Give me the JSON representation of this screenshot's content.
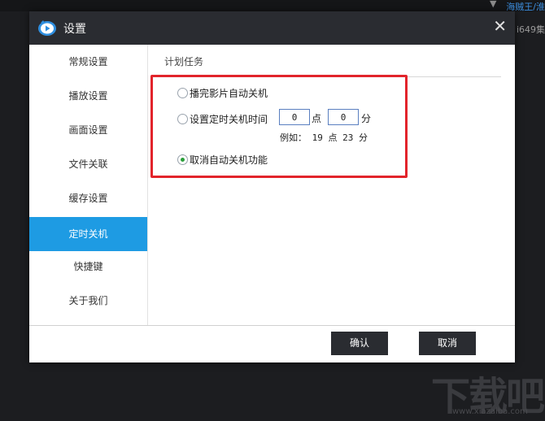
{
  "background": {
    "top_right_text": "海贼王/淮",
    "top_right_text2": "i649集",
    "chevron": "▼"
  },
  "dialog": {
    "title": "设置",
    "close_symbol": "✕",
    "sidebar": {
      "items": [
        {
          "label": "常规设置",
          "active": false
        },
        {
          "label": "播放设置",
          "active": false
        },
        {
          "label": "画面设置",
          "active": false
        },
        {
          "label": "文件关联",
          "active": false
        },
        {
          "label": "缓存设置",
          "active": false
        },
        {
          "label": "定时关机",
          "active": true
        },
        {
          "label": "快捷键",
          "active": false
        },
        {
          "label": "关于我们",
          "active": false
        }
      ]
    },
    "content": {
      "section_title": "计划任务",
      "options": {
        "after_movie": {
          "label": "播完影片自动关机",
          "checked": false
        },
        "set_time": {
          "label": "设置定时关机时间",
          "checked": false
        },
        "cancel": {
          "label": "取消自动关机功能",
          "checked": true
        }
      },
      "hour_value": "0",
      "hour_unit": "点",
      "minute_value": "0",
      "minute_unit": "分",
      "example": "例如： 19 点 23 分"
    },
    "buttons": {
      "confirm": "确认",
      "cancel": "取消"
    }
  },
  "watermark": {
    "logo_text": "下载吧",
    "url": "www.xiazaiba.com"
  },
  "colors": {
    "accent": "#1e9be3",
    "highlight_border": "#e2242b",
    "titlebar": "#2a2c31",
    "radio_checked": "#2a9e3a"
  }
}
